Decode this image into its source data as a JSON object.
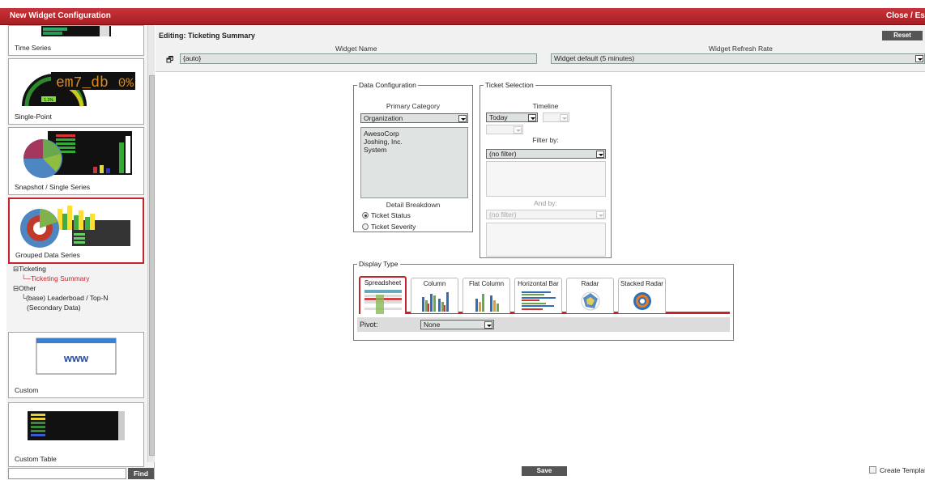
{
  "window": {
    "title": "New Widget Configuration",
    "close_label": "Close / Esc"
  },
  "sidebar": {
    "cards": [
      {
        "label": "Time Series"
      },
      {
        "label": "Single-Point",
        "thumb_text": "em7_db",
        "thumb_value": "0%"
      },
      {
        "label": "Snapshot / Single Series"
      },
      {
        "label": "Grouped Data Series"
      },
      {
        "label": "Custom",
        "thumb_text": "www"
      },
      {
        "label": "Custom Table"
      }
    ],
    "tree": [
      {
        "label": "Ticketing",
        "level": 0
      },
      {
        "label": "Ticketing Summary",
        "level": 1,
        "selected": true
      },
      {
        "label": "Other",
        "level": 0
      },
      {
        "label": "(base) Leaderboad / Top-N",
        "level": 1
      },
      {
        "label": "(Secondary Data)",
        "level": 1
      }
    ],
    "find_label": "Find",
    "find_value": ""
  },
  "editor": {
    "title": "Editing: Ticketing Summary",
    "reset_label": "Reset",
    "widget_name_label": "Widget Name",
    "widget_name_value": "{auto}",
    "refresh_label": "Widget Refresh Rate",
    "refresh_value": "Widget default (5 minutes)",
    "data_config": {
      "legend": "Data Configuration",
      "primary_category_label": "Primary Category",
      "primary_category_value": "Organization",
      "items": [
        "AwesoCorp",
        "Joshing, Inc.",
        "System"
      ],
      "detail_label": "Detail Breakdown",
      "radio_status": "Ticket Status",
      "radio_severity": "Ticket Severity",
      "selected": "Ticket Status"
    },
    "ticket_selection": {
      "legend": "Ticket Selection",
      "timeline_label": "Timeline",
      "timeline_value": "Today",
      "filter_label": "Filter by:",
      "filter_value": "(no filter)",
      "and_label": "And by:",
      "and_value": "(no filter)"
    },
    "display_type": {
      "legend": "Display Type",
      "tabs": [
        "Spreadsheet",
        "Column",
        "Flat Column",
        "Horizontal Bar",
        "Radar",
        "Stacked Radar"
      ],
      "active": "Spreadsheet",
      "pivot_label": "Pivot:",
      "pivot_value": "None"
    },
    "save_label": "Save",
    "create_template_label": "Create Template"
  },
  "colors": {
    "brand_red": "#c0262d",
    "button_dark": "#555555",
    "field_bg": "#dfe3e1"
  }
}
